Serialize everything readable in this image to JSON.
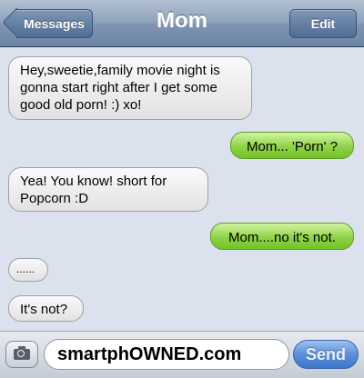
{
  "header": {
    "back_label": "Messages",
    "title": "Mom",
    "edit_label": "Edit"
  },
  "messages": [
    {
      "direction": "incoming",
      "text": "Hey,sweetie,family movie night is gonna start right after I get some good old porn! :) xo!"
    },
    {
      "direction": "outgoing",
      "text": "Mom... 'Porn' ?"
    },
    {
      "direction": "incoming",
      "text": "Yea! You know! short for Popcorn :D"
    },
    {
      "direction": "outgoing",
      "text": "Mom....no it's not."
    },
    {
      "direction": "incoming",
      "text": "......"
    },
    {
      "direction": "incoming",
      "text": "It's not?"
    }
  ],
  "compose": {
    "input_value": "smartphOWNED.com",
    "send_label": "Send",
    "camera_icon": "camera-icon"
  },
  "colors": {
    "navbar": "#8ea2bc",
    "background": "#dbe2ed",
    "outgoing_bubble": "#8fd34a",
    "incoming_bubble": "#ececec",
    "send_button": "#5b8fd8"
  }
}
